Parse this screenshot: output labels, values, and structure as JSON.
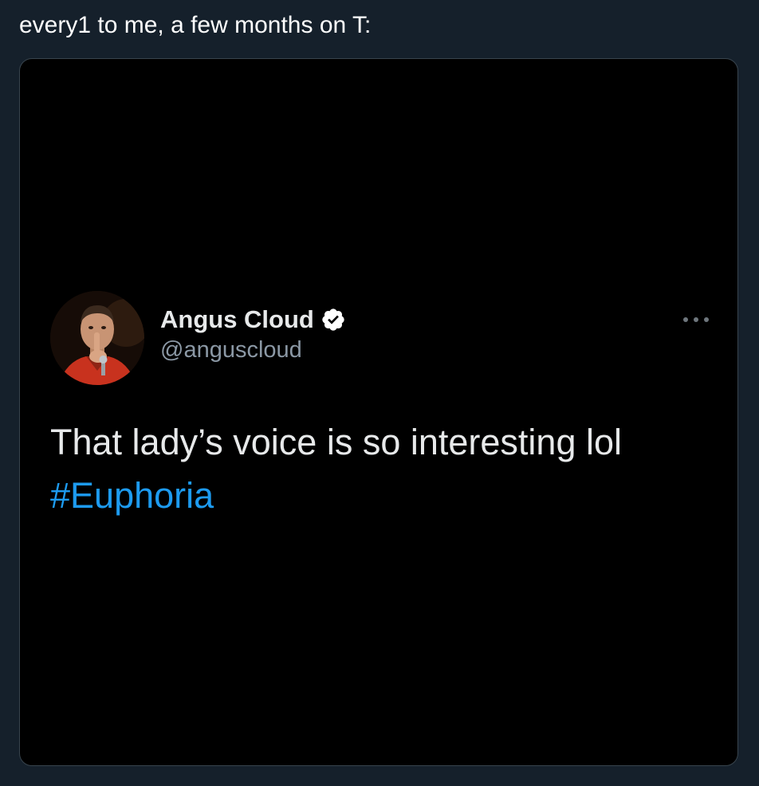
{
  "caption": "every1 to me, a few months on T:",
  "tweet": {
    "display_name": "Angus Cloud",
    "handle": "@anguscloud",
    "verified": true,
    "text": "That lady’s voice is so interesting lol",
    "hashtag": "#Euphoria"
  },
  "icons": {
    "verified": "verified-badge-icon",
    "more": "more-options-icon"
  },
  "colors": {
    "page_background": "#15202b",
    "card_background": "#000000",
    "link": "#1d9bf0",
    "secondary_text": "#8b98a5"
  }
}
